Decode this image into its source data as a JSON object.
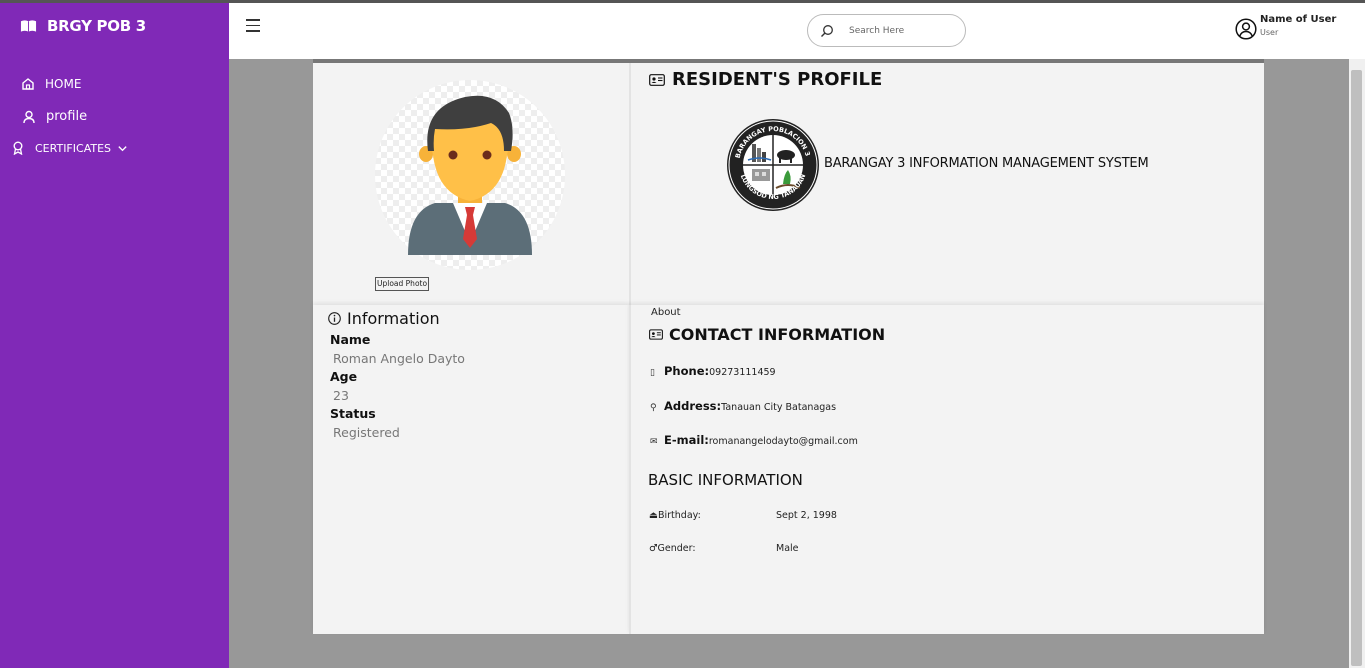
{
  "sidebar": {
    "brand": "BRGY POB 3",
    "items": [
      {
        "label": "HOME"
      },
      {
        "label": "profile"
      },
      {
        "label": "CERTIFICATES"
      }
    ]
  },
  "header": {
    "search_placeholder": "Search Here",
    "user_name": "Name of User",
    "user_role": "User"
  },
  "photo": {
    "upload_label": "Upload Photo"
  },
  "profile": {
    "title": "RESIDENT'S PROFILE",
    "system_name": "BARANGAY 3 INFORMATION MANAGEMENT SYSTEM",
    "seal_text": "BARANGAY POBLACION 3 · LUNGSOD NG TANAUAN"
  },
  "information": {
    "title": "Information",
    "name_label": "Name",
    "name_value": "Roman Angelo Dayto",
    "age_label": "Age",
    "age_value": "23",
    "status_label": "Status",
    "status_value": "Registered"
  },
  "contact": {
    "about_label": "About",
    "title": "CONTACT INFORMATION",
    "phone_label": "Phone:",
    "phone_value": "09273111459",
    "address_label": "Address:",
    "address_value": "Tanauan City Batanagas",
    "email_label": "E-mail:",
    "email_value": "romanangelodayto@gmail.com"
  },
  "basic": {
    "title": "BASIC INFORMATION",
    "birthday_label": "Birthday:",
    "birthday_value": "Sept 2, 1998",
    "gender_label": "Gender:",
    "gender_value": "Male"
  },
  "colors": {
    "sidebar": "#8029b7",
    "panel": "#f3f3f3",
    "background": "#989898"
  }
}
